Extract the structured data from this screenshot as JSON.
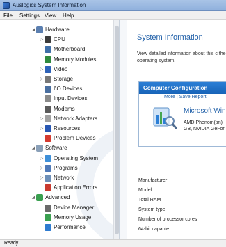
{
  "window": {
    "title": "Auslogics System Information"
  },
  "menu": [
    "File",
    "Settings",
    "View",
    "Help"
  ],
  "tree": [
    {
      "label": "Hardware",
      "level": 0,
      "arrow": "expanded",
      "icon": "hardware-icon",
      "color": "#5b7fb0"
    },
    {
      "label": "CPU",
      "level": 1,
      "arrow": "collapsed",
      "icon": "cpu-icon",
      "color": "#3b3b3b"
    },
    {
      "label": "Motherboard",
      "level": 1,
      "arrow": "",
      "icon": "motherboard-icon",
      "color": "#3f6fa8"
    },
    {
      "label": "Memory Modules",
      "level": 1,
      "arrow": "",
      "icon": "memory-icon",
      "color": "#2f8a3e"
    },
    {
      "label": "Video",
      "level": 1,
      "arrow": "collapsed",
      "icon": "video-icon",
      "color": "#2e62b8"
    },
    {
      "label": "Storage",
      "level": 1,
      "arrow": "collapsed",
      "icon": "storage-icon",
      "color": "#777777"
    },
    {
      "label": "I\\O Devices",
      "level": 1,
      "arrow": "",
      "icon": "io-devices-icon",
      "color": "#4a6fa0"
    },
    {
      "label": "Input Devices",
      "level": 1,
      "arrow": "",
      "icon": "input-devices-icon",
      "color": "#8a8a8a"
    },
    {
      "label": "Modems",
      "level": 1,
      "arrow": "",
      "icon": "modem-icon",
      "color": "#5b5b5b"
    },
    {
      "label": "Network Adapters",
      "level": 1,
      "arrow": "collapsed",
      "icon": "network-adapter-icon",
      "color": "#a0a0a0"
    },
    {
      "label": "Resources",
      "level": 1,
      "arrow": "collapsed",
      "icon": "resources-icon",
      "color": "#2857b3"
    },
    {
      "label": "Problem Devices",
      "level": 1,
      "arrow": "",
      "icon": "problem-devices-icon",
      "color": "#d43a2f"
    },
    {
      "label": "Software",
      "level": 0,
      "arrow": "expanded",
      "icon": "software-icon",
      "color": "#8aa0b8"
    },
    {
      "label": "Operating System",
      "level": 1,
      "arrow": "collapsed",
      "icon": "operating-system-icon",
      "color": "#3e8fd8"
    },
    {
      "label": "Programs",
      "level": 1,
      "arrow": "collapsed",
      "icon": "programs-icon",
      "color": "#4f79b8"
    },
    {
      "label": "Network",
      "level": 1,
      "arrow": "collapsed",
      "icon": "network-icon",
      "color": "#6d8fb8"
    },
    {
      "label": "Application Errors",
      "level": 1,
      "arrow": "",
      "icon": "application-errors-icon",
      "color": "#c93a2f"
    },
    {
      "label": "Advanced",
      "level": 0,
      "arrow": "expanded",
      "icon": "advanced-icon",
      "color": "#3aa050"
    },
    {
      "label": "Device Manager",
      "level": 1,
      "arrow": "",
      "icon": "device-manager-icon",
      "color": "#6a6a6a"
    },
    {
      "label": "Memory Usage",
      "level": 1,
      "arrow": "",
      "icon": "memory-usage-icon",
      "color": "#3aa050"
    },
    {
      "label": "Performance",
      "level": 1,
      "arrow": "",
      "icon": "performance-icon",
      "color": "#2e7bd0"
    }
  ],
  "main": {
    "title": "System Information",
    "description": "View detailed information about this c the operating system.",
    "config": {
      "header": "Computer Configuration",
      "os_title": "Microsoft Win",
      "spec_line1": "AMD Phenom(tm)",
      "spec_line2": "GB, NVIDIA GeFor",
      "more_link": "More",
      "separator": "|",
      "save_link": "Save Report"
    },
    "properties": [
      "Manufacturer",
      "Model",
      "Total RAM",
      "System type",
      "Number of processor cores",
      "64-bit capable"
    ]
  },
  "status": {
    "text": "Ready"
  },
  "colors": {
    "accent": "#1f5fa8",
    "header": "#1763b7"
  }
}
